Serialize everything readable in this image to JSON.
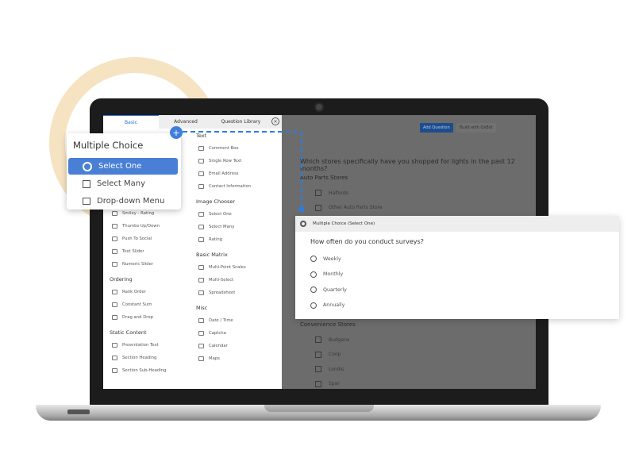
{
  "tabs": [
    "Basic",
    "Advanced",
    "Question Library"
  ],
  "left_col": [
    {
      "header": "",
      "items": []
    },
    {
      "header": null,
      "items": [
        "Smiley - Rating",
        "Thumbs Up/Down",
        "Push To Social",
        "Text Slider",
        "Numeric Slider"
      ]
    },
    {
      "header": "Ordering",
      "items": [
        "Rank Order",
        "Constant Sum",
        "Drag and Drop"
      ]
    },
    {
      "header": "Static Content",
      "items": [
        "Presentation Text",
        "Section Heading",
        "Section Sub-Heading"
      ]
    }
  ],
  "right_col": [
    {
      "header": "Text",
      "items": [
        "Comment Box",
        "Single Row Text",
        "Email Address",
        "Contact Information"
      ]
    },
    {
      "header": "Image Chooser",
      "items": [
        "Select One",
        "Select Many",
        "Rating"
      ]
    },
    {
      "header": "Basic Matrix",
      "items": [
        "Multi-Point Scales",
        "Multi-Select",
        "Spreadsheet"
      ]
    },
    {
      "header": "Misc",
      "items": [
        "Date / Time",
        "Captcha",
        "Calendar",
        "Maps"
      ]
    }
  ],
  "menu": {
    "title": "Multiple Choice",
    "items": [
      "Select One",
      "Select Many",
      "Drop-down Menu"
    ],
    "selected": 0
  },
  "main": {
    "add_question": "Add Question",
    "build_qxbot": "Build with QxBot",
    "question": "Which stores specifically have you shopped for lights in the past 12 months?",
    "group1": "Auto Parts Stores",
    "group1_options": [
      "Halfords",
      "Other Auto Parts Store"
    ],
    "group2": "Convenience Stores",
    "group2_options": [
      "Budgens",
      "Coop",
      "Londis",
      "Spar"
    ]
  },
  "popup": {
    "type": "Multiple Choice (Select One)",
    "question": "How often do you conduct surveys?",
    "options": [
      "Weekly",
      "Monthly",
      "Quarterly",
      "Annually"
    ]
  },
  "colors": {
    "accent": "#2d6fd2",
    "selected": "#4a7fd6",
    "ring": "#f6e3c2",
    "button": "#1d4d8f"
  }
}
